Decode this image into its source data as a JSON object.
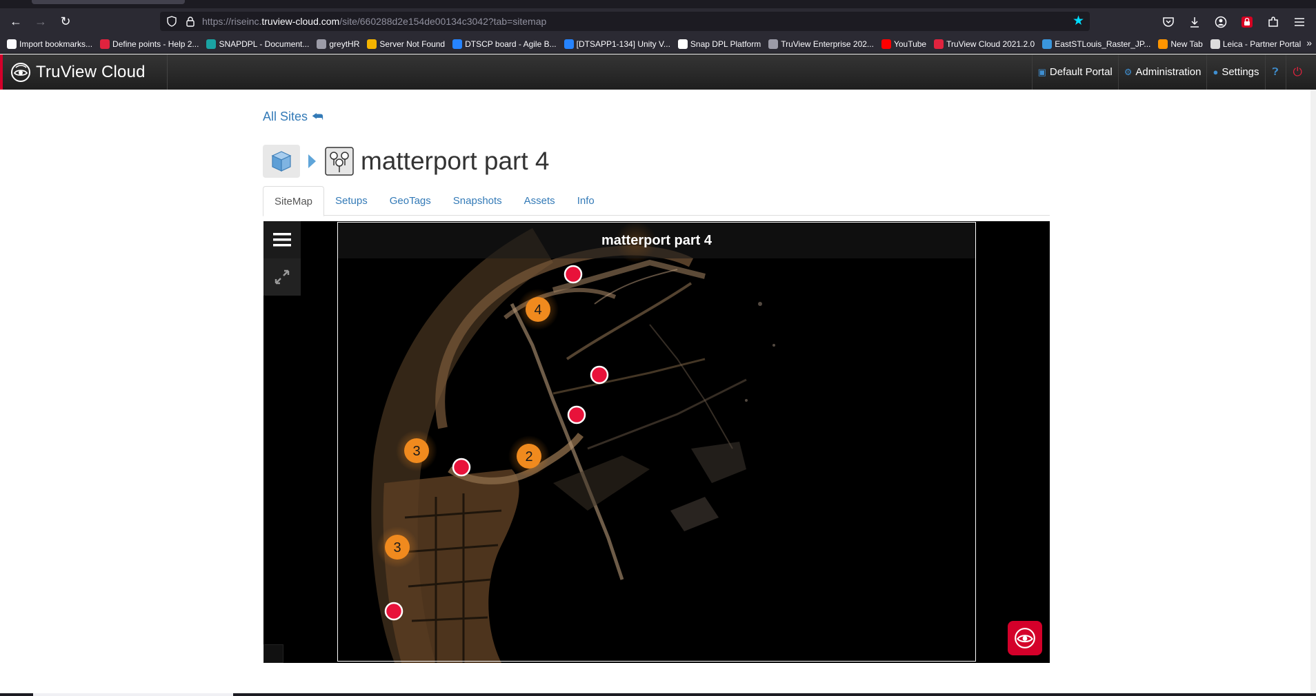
{
  "browser": {
    "url_prefix": "https://riseinc.",
    "url_host": "truview-cloud.com",
    "url_path": "/site/660288d2e154de00134c3042?tab=sitemap",
    "bookmarks": [
      {
        "label": "Import bookmarks...",
        "color": "#fbfbfe"
      },
      {
        "label": "Define points - Help 2...",
        "color": "#e0233e"
      },
      {
        "label": "SNAPDPL - Document...",
        "color": "#1aa3a3"
      },
      {
        "label": "greytHR",
        "color": "#9c9ca8"
      },
      {
        "label": "Server Not Found",
        "color": "#f4b400"
      },
      {
        "label": "DTSCP board - Agile B...",
        "color": "#2684ff"
      },
      {
        "label": "[DTSAPP1-134] Unity V...",
        "color": "#2684ff"
      },
      {
        "label": "Snap DPL Platform",
        "color": "#ffffff"
      },
      {
        "label": "TruView Enterprise 202...",
        "color": "#9c9ca8"
      },
      {
        "label": "YouTube",
        "color": "#ff0000"
      },
      {
        "label": "TruView Cloud 2021.2.0",
        "color": "#e0233e"
      },
      {
        "label": "EastSTLouis_Raster_JP...",
        "color": "#3a96dd"
      },
      {
        "label": "New Tab",
        "color": "#ff9500"
      },
      {
        "label": "Leica - Partner Portal",
        "color": "#dddddd"
      }
    ]
  },
  "app": {
    "brand": "TruView Cloud",
    "nav": {
      "portal": "Default Portal",
      "admin": "Administration",
      "settings": "Settings"
    }
  },
  "page": {
    "all_sites": "All Sites",
    "site_title": "matterport part 4",
    "tabs": [
      "SiteMap",
      "Setups",
      "GeoTags",
      "Snapshots",
      "Assets",
      "Info"
    ],
    "active_tab": "SiteMap"
  },
  "sitemap": {
    "title": "matterport part 4",
    "clusters": [
      "4",
      "3",
      "2",
      "3"
    ],
    "setup_marker_color": "#e8123a",
    "cluster_color": "#f08a1e"
  }
}
